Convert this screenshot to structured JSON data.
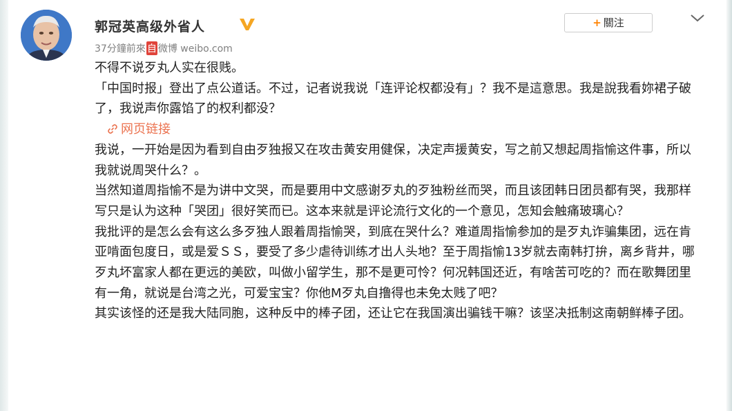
{
  "user": {
    "name": "郭冠英高级外省人",
    "verified_icon": "verified-v-badge",
    "brand_color": "#f5a623"
  },
  "meta": {
    "time": "37分鐘前",
    "via": "來",
    "source_mark": "自",
    "app": "微博",
    "domain": "weibo.com"
  },
  "actions": {
    "follow_label": "關注",
    "follow_icon": "plus-icon",
    "more_icon": "chevron-down-icon"
  },
  "post": {
    "p1": "不得不说歹丸人实在很贱。",
    "p2": "「中国时报」登出了点公道话。不过，记者说我说「连评论权都没有」？我不是這意思。我是說我看妳裙子破了，我说声你露馅了的权利都没？",
    "link_icon": "link-icon",
    "link_label": "网页链接",
    "p3": "我说，一开始是因为看到自由歹独报又在攻击黄安用健保，决定声援黄安，写之前又想起周指愉这件事，所以我就说周哭什么？。",
    "p4": "当然知道周指愉不是为讲中文哭，而是要用中文感谢歹丸的歹独粉丝而哭，而且该团韩日团员都有哭，我那样写只是认为这种「哭团」很好笑而已。这本来就是评论流行文化的一个意见，怎知会触痛玻璃心？",
    "p5": "我批评的是怎么会有这么多歹独人跟着周指愉哭，到底在哭什么？难道周指愉参加的是歹丸诈骗集团，远在肯亚啃面包度日，或是爱ＳＳ，要受了多少虐待训练才出人头地？至于周指愉13岁就去南韩打拚，离乡背井，哪歹丸坏富家人都在更远的美欧，叫做小留学生，那不是更可怜？何况韩国还近，有啥苦可吃的？而在歌舞团里有一角，就说是台湾之光，可爱宝宝？你他M歹丸自撸得也未免太贱了吧？",
    "p6": "其实该怪的还是我大陆同胞，这种反中的棒子团，还让它在我国演出骗钱干嘛？该坚决抵制这南朝鲜棒子团。",
    "link_color": "#eb7350"
  }
}
